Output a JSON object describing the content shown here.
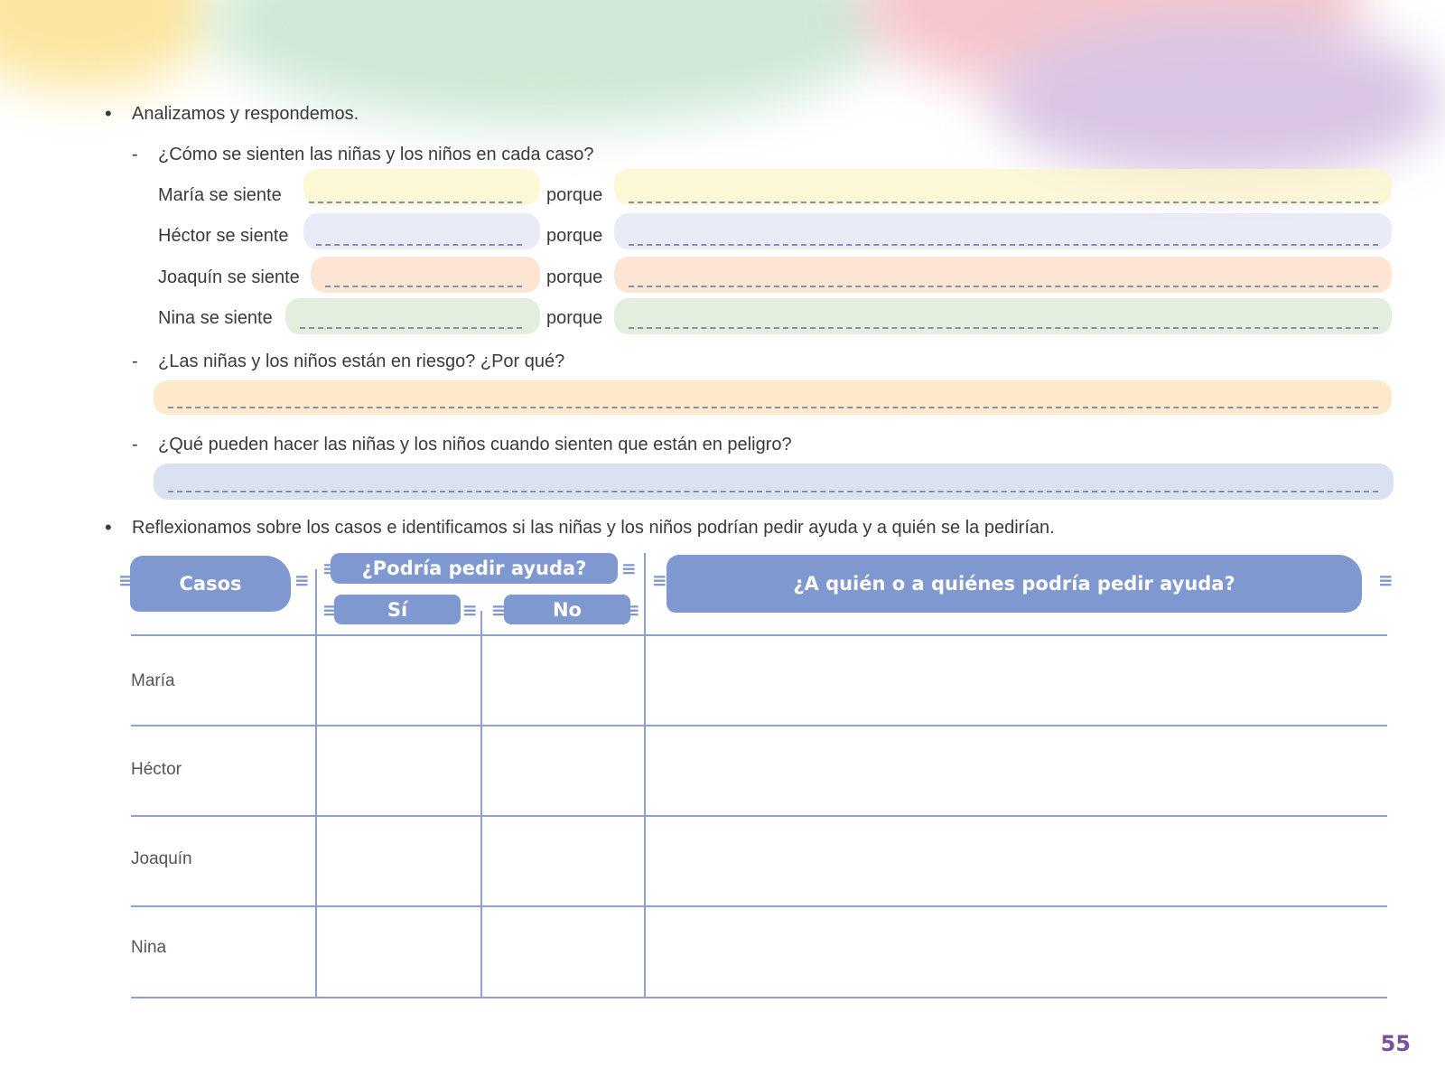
{
  "section1": {
    "instruction": "Analizamos y respondemos.",
    "q1": "¿Cómo se sienten las niñas y los niños en cada caso?",
    "feelings": [
      {
        "label": "María se siente",
        "porque": "porque",
        "color": "#fbf5c8"
      },
      {
        "label": "Héctor se siente",
        "porque": "porque",
        "color": "#e1e4f4"
      },
      {
        "label": "Joaquín se siente",
        "porque": "porque",
        "color": "#fcdcc4"
      },
      {
        "label": "Nina se siente",
        "porque": "porque",
        "color": "#d8ead4"
      }
    ],
    "q2": "¿Las niñas y los niños están en riesgo? ¿Por qué?",
    "q3": "¿Qué pueden hacer las niñas y los niños cuando sienten que están en peligro?"
  },
  "section2": {
    "instruction": "Reflexionamos sobre los casos e identificamos si las niñas y los niños podrían pedir ayuda y a quién se la pedirían.",
    "headers": {
      "casos": "Casos",
      "podria": "¿Podría pedir ayuda?",
      "si": "Sí",
      "no": "No",
      "quien": "¿A quién o a quiénes podría pedir ayuda?"
    },
    "rows": [
      "María",
      "Héctor",
      "Joaquín",
      "Nina"
    ]
  },
  "page_number": "55",
  "colors": {
    "banner": "#7f98cf",
    "lines": "#8ea1cf"
  }
}
